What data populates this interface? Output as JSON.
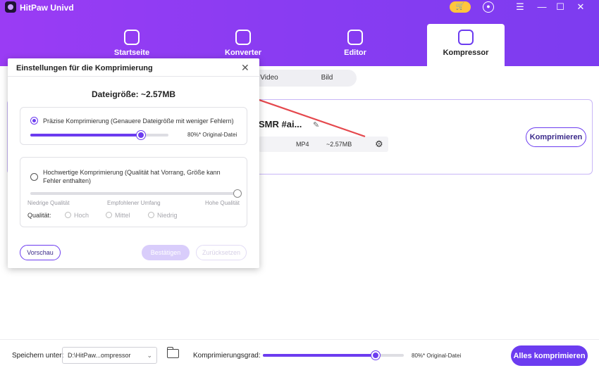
{
  "app": {
    "title": "HitPaw Univd"
  },
  "window_icons": {
    "cart": "cart-icon",
    "user": "user-icon",
    "menu": "menu-icon",
    "minimize": "minimize-icon",
    "maximize": "maximize-icon",
    "close": "close-icon"
  },
  "nav": {
    "tabs": [
      {
        "label": "Startseite",
        "icon": "home-icon"
      },
      {
        "label": "Konverter",
        "icon": "convert-icon"
      },
      {
        "label": "Editor",
        "icon": "edit-icon"
      },
      {
        "label": "Kompressor",
        "icon": "compress-icon",
        "active": true
      }
    ]
  },
  "media_toggle": {
    "video": "Video",
    "image": "Bild"
  },
  "file": {
    "name": "SMR #ai...",
    "format": "MP4",
    "size": "~2.57MB",
    "compress_label": "Komprimieren"
  },
  "dialog": {
    "title": "Einstellungen für die Komprimierung",
    "file_size": "Dateigröße:  ~2.57MB",
    "option_precise": {
      "label": "Präzise Komprimierung (Genauere Dateigröße mit weniger Fehlern)",
      "selected": true,
      "slider_percent": 80,
      "slider_value_label": "80%* Original-Datei"
    },
    "option_quality": {
      "label": "Hochwertige Komprimierung (Qualität hat Vorrang, Größe kann Fehler enthalten)",
      "selected": false,
      "slider_percent": 100,
      "scale": {
        "low": "Niedrige Qualität",
        "mid": "Empfohlener Umfang",
        "high": "Hohe Qualität"
      },
      "quality_label": "Qualität:",
      "quality_options": [
        "Hoch",
        "Mittel",
        "Niedrig"
      ]
    },
    "buttons": {
      "preview": "Vorschau",
      "confirm": "Bestätigen",
      "reset": "Zurücksetzen"
    }
  },
  "bottom_bar": {
    "save_label": "Speichern unter:",
    "save_path": "D:\\HitPaw...ompressor",
    "grade_label": "Komprimierungsgrad:",
    "grade_percent": 80,
    "grade_value_label": "80%* Original-Datei",
    "compress_all_label": "Alles komprimieren"
  },
  "colors": {
    "accent": "#6c3cf0",
    "header_gradient_start": "#9a3cf4",
    "arrow": "#e5484d"
  }
}
